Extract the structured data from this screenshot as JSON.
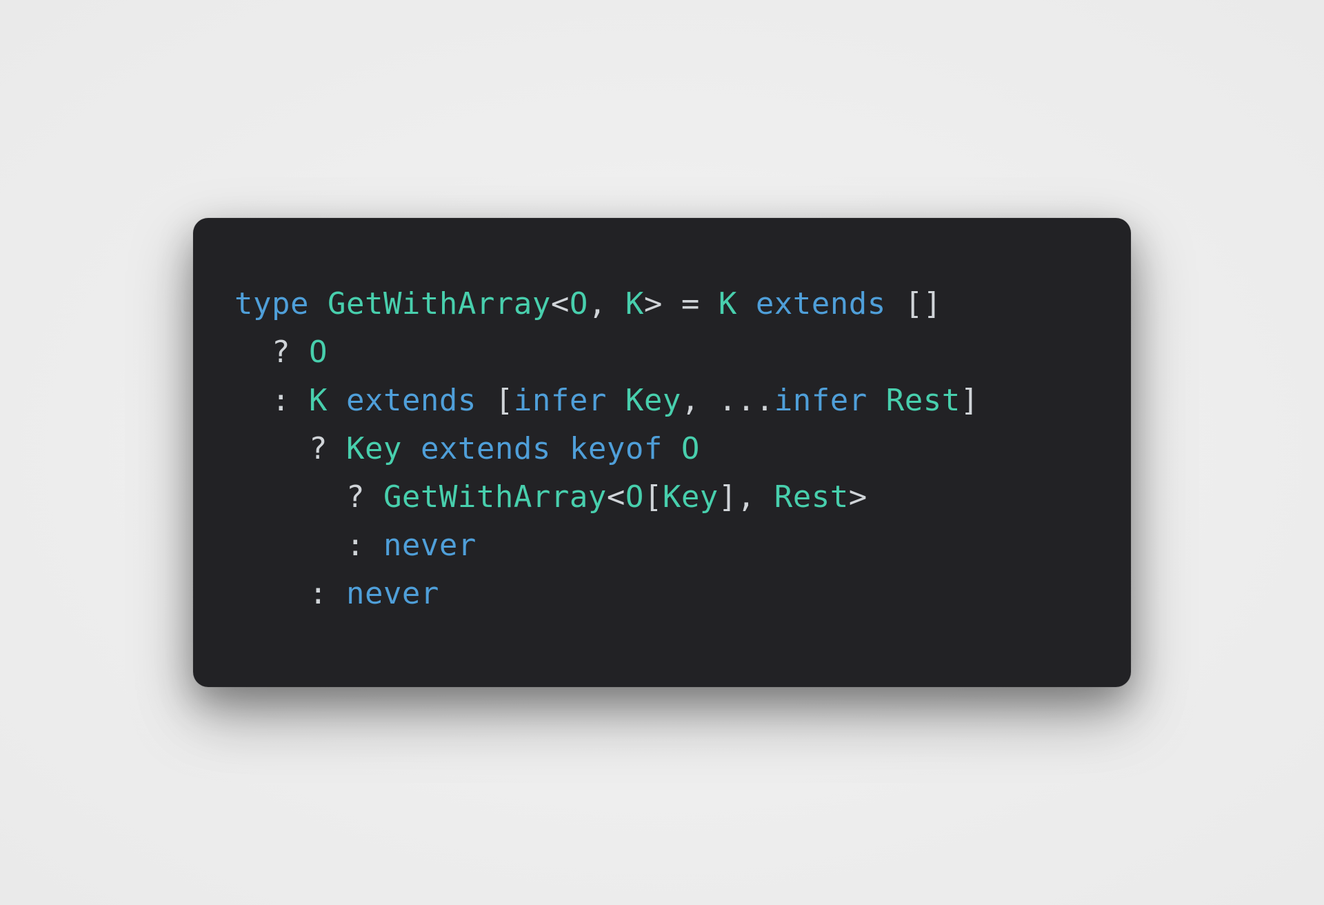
{
  "code": {
    "lines": [
      {
        "indent": 0,
        "tokens": [
          {
            "c": "kw",
            "t": "type"
          },
          {
            "c": "p",
            "t": " "
          },
          {
            "c": "ty",
            "t": "GetWithArray"
          },
          {
            "c": "p",
            "t": "<"
          },
          {
            "c": "ty",
            "t": "O"
          },
          {
            "c": "p",
            "t": ", "
          },
          {
            "c": "ty",
            "t": "K"
          },
          {
            "c": "p",
            "t": "> = "
          },
          {
            "c": "ty",
            "t": "K"
          },
          {
            "c": "p",
            "t": " "
          },
          {
            "c": "kw",
            "t": "extends"
          },
          {
            "c": "p",
            "t": " []"
          }
        ]
      },
      {
        "indent": 1,
        "tokens": [
          {
            "c": "p",
            "t": "? "
          },
          {
            "c": "ty",
            "t": "O"
          }
        ]
      },
      {
        "indent": 1,
        "tokens": [
          {
            "c": "p",
            "t": ": "
          },
          {
            "c": "ty",
            "t": "K"
          },
          {
            "c": "p",
            "t": " "
          },
          {
            "c": "kw",
            "t": "extends"
          },
          {
            "c": "p",
            "t": " ["
          },
          {
            "c": "kw",
            "t": "infer"
          },
          {
            "c": "p",
            "t": " "
          },
          {
            "c": "ty",
            "t": "Key"
          },
          {
            "c": "p",
            "t": ", ..."
          },
          {
            "c": "kw",
            "t": "infer"
          },
          {
            "c": "p",
            "t": " "
          },
          {
            "c": "ty",
            "t": "Rest"
          },
          {
            "c": "p",
            "t": "]"
          }
        ]
      },
      {
        "indent": 2,
        "tokens": [
          {
            "c": "p",
            "t": "? "
          },
          {
            "c": "ty",
            "t": "Key"
          },
          {
            "c": "p",
            "t": " "
          },
          {
            "c": "kw",
            "t": "extends"
          },
          {
            "c": "p",
            "t": " "
          },
          {
            "c": "kw",
            "t": "keyof"
          },
          {
            "c": "p",
            "t": " "
          },
          {
            "c": "ty",
            "t": "O"
          }
        ]
      },
      {
        "indent": 3,
        "tokens": [
          {
            "c": "p",
            "t": "? "
          },
          {
            "c": "ty",
            "t": "GetWithArray"
          },
          {
            "c": "p",
            "t": "<"
          },
          {
            "c": "ty",
            "t": "O"
          },
          {
            "c": "p",
            "t": "["
          },
          {
            "c": "ty",
            "t": "Key"
          },
          {
            "c": "p",
            "t": "], "
          },
          {
            "c": "ty",
            "t": "Rest"
          },
          {
            "c": "p",
            "t": ">"
          }
        ]
      },
      {
        "indent": 3,
        "tokens": [
          {
            "c": "p",
            "t": ": "
          },
          {
            "c": "kw",
            "t": "never"
          }
        ]
      },
      {
        "indent": 2,
        "tokens": [
          {
            "c": "p",
            "t": ": "
          },
          {
            "c": "kw",
            "t": "never"
          }
        ]
      }
    ],
    "indent_unit": "  "
  }
}
